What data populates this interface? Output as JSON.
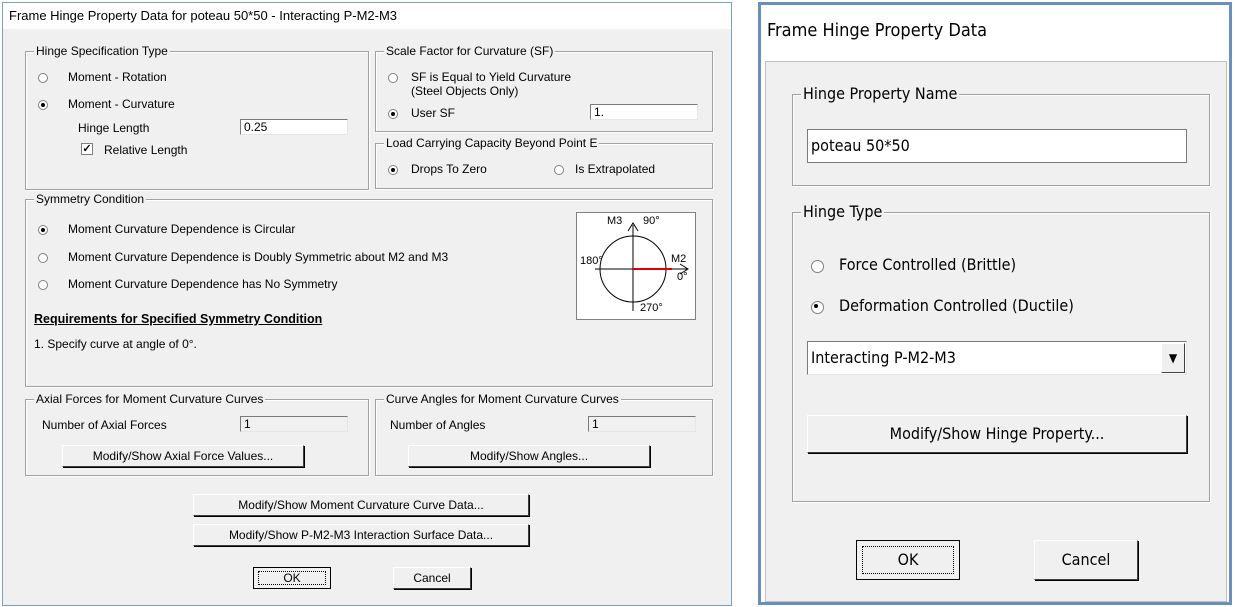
{
  "left_dialog": {
    "title": "Frame Hinge Property Data for poteau 50*50 - Interacting P-M2-M3",
    "hinge_spec": {
      "group_label": "Hinge Specification Type",
      "option_rotation": "Moment - Rotation",
      "option_curvature": "Moment - Curvature",
      "hinge_length_label": "Hinge Length",
      "hinge_length_value": "0.25",
      "relative_length_label": "Relative Length",
      "selected": "Moment - Curvature",
      "relative_length_checked": true
    },
    "scale_factor": {
      "group_label": "Scale Factor for Curvature (SF)",
      "option_yield": "SF is Equal to Yield Curvature",
      "option_yield_note": "(Steel Objects Only)",
      "option_user": "User SF",
      "user_sf_value": "1.",
      "selected": "User SF"
    },
    "load_capacity": {
      "group_label": "Load Carrying Capacity Beyond Point E",
      "option_zero": "Drops To Zero",
      "option_extrapolated": "Is Extrapolated",
      "selected": "Drops To Zero"
    },
    "symmetry": {
      "group_label": "Symmetry Condition",
      "option_circular": "Moment Curvature Dependence is Circular",
      "option_doubly": "Moment Curvature Dependence is Doubly Symmetric about M2 and M3",
      "option_none": "Moment Curvature Dependence has No Symmetry",
      "selected": "Moment Curvature Dependence is Circular",
      "requirements_title": "Requirements for Specified Symmetry Condition",
      "requirement_1": "1.   Specify curve at angle of 0°.",
      "diagram": {
        "m3_label": "M3",
        "m2_label": "M2",
        "angle_90": "90°",
        "angle_180": "180°",
        "angle_0": "0°",
        "angle_270": "270°",
        "highlight_color": "#e00000"
      }
    },
    "axial_forces": {
      "group_label": "Axial Forces for Moment Curvature Curves",
      "count_label": "Number of Axial Forces",
      "count_value": "1",
      "button": "Modify/Show Axial Force Values..."
    },
    "curve_angles": {
      "group_label": "Curve Angles for Moment Curvature Curves",
      "count_label": "Number of Angles",
      "count_value": "1",
      "button": "Modify/Show Angles..."
    },
    "btn_moment_curvature": "Modify/Show Moment Curvature Curve Data...",
    "btn_interaction": "Modify/Show P-M2-M3 Interaction Surface Data...",
    "btn_ok": "OK",
    "btn_cancel": "Cancel"
  },
  "right_dialog": {
    "title": "Frame Hinge Property Data",
    "name_group_label": "Hinge Property Name",
    "name_value": "poteau 50*50",
    "type_group_label": "Hinge Type",
    "option_force": "Force Controlled  (Brittle)",
    "option_deformation": "Deformation Controlled  (Ductile)",
    "selected": "Deformation Controlled  (Ductile)",
    "hinge_type_select": "Interacting P-M2-M3",
    "dropdown_icon": "triangle-down",
    "btn_modify": "Modify/Show Hinge Property...",
    "btn_ok": "OK",
    "btn_cancel": "Cancel"
  },
  "colors": {
    "dialog_bg": "#f0f0f0",
    "window_frame": "#6a8fbf",
    "accent_red": "#e00000"
  }
}
